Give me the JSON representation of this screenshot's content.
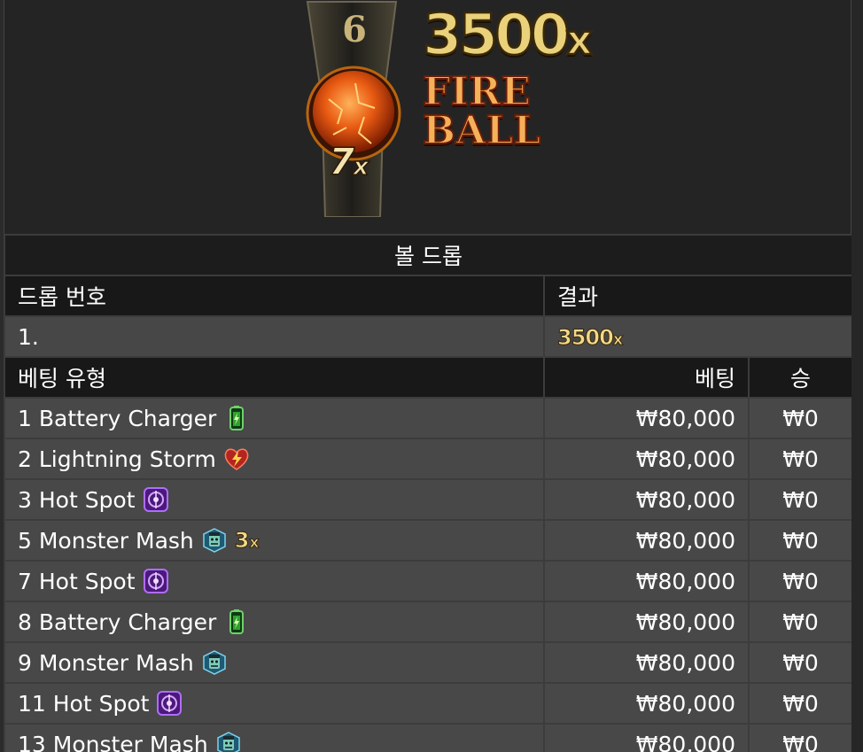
{
  "hero": {
    "drop_number": "6",
    "big_multiplier": "3500",
    "big_multiplier_suffix": "x",
    "title_line1": "FIRE",
    "title_line2": "BALL",
    "ball_multiplier": "7",
    "ball_multiplier_suffix": "x"
  },
  "table": {
    "title": "볼 드롭",
    "headers": {
      "drop_number": "드롭 번호",
      "result": "결과"
    },
    "drop_rows": [
      {
        "drop": "1.",
        "result": "3500",
        "result_suffix": "x"
      }
    ],
    "bet_headers": {
      "bet_type": "베팅 유형",
      "bet": "베팅",
      "win": "승"
    },
    "bets": [
      {
        "label": "1 Battery Charger",
        "icon": "battery-icon",
        "multiplier": "",
        "bet": "₩80,000",
        "win": "₩0"
      },
      {
        "label": "2 Lightning Storm",
        "icon": "lightning-storm-icon",
        "multiplier": "",
        "bet": "₩80,000",
        "win": "₩0"
      },
      {
        "label": "3 Hot Spot",
        "icon": "hot-spot-icon",
        "multiplier": "",
        "bet": "₩80,000",
        "win": "₩0"
      },
      {
        "label": "5 Monster Mash",
        "icon": "monster-mash-icon",
        "multiplier": "3",
        "bet": "₩80,000",
        "win": "₩0"
      },
      {
        "label": "7 Hot Spot",
        "icon": "hot-spot-icon",
        "multiplier": "",
        "bet": "₩80,000",
        "win": "₩0"
      },
      {
        "label": "8 Battery Charger",
        "icon": "battery-icon",
        "multiplier": "",
        "bet": "₩80,000",
        "win": "₩0"
      },
      {
        "label": "9 Monster Mash",
        "icon": "monster-mash-icon",
        "multiplier": "",
        "bet": "₩80,000",
        "win": "₩0"
      },
      {
        "label": "11 Hot Spot",
        "icon": "hot-spot-icon",
        "multiplier": "",
        "bet": "₩80,000",
        "win": "₩0"
      },
      {
        "label": "13 Monster Mash",
        "icon": "monster-mash-icon",
        "multiplier": "",
        "bet": "₩80,000",
        "win": "₩0"
      }
    ],
    "multiplier_suffix": "x"
  }
}
